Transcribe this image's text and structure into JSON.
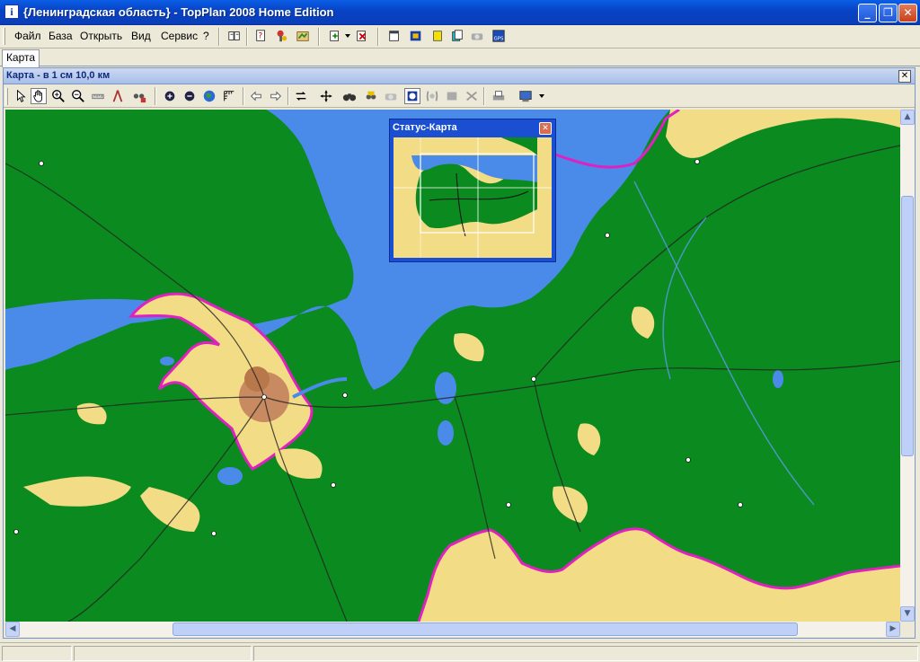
{
  "window": {
    "title": "{Ленинградская область} - TopPlan 2008 Home Edition",
    "app_icon_glyph": "i",
    "min_glyph": "_",
    "max_glyph": "❐",
    "close_glyph": "✕"
  },
  "menu": [
    {
      "label": "Файл"
    },
    {
      "label": "База"
    },
    {
      "label": "Открыть"
    },
    {
      "label": "Вид"
    },
    {
      "label": "Сервис"
    },
    {
      "label": "?"
    }
  ],
  "main_toolbar": [
    "book-icon",
    "help-cursor-icon",
    "tools-icon",
    "map-settings-icon",
    "add-layer-icon",
    "delete-layer-icon",
    "window-icon",
    "layers-icon",
    "note-icon",
    "copy-icon",
    "camera-icon",
    "gps-icon"
  ],
  "tabs": [
    {
      "label": "Карта"
    }
  ],
  "map_window": {
    "title": "Карта - в 1 см 10,0 км",
    "close_glyph": "✕"
  },
  "map_toolbar": [
    "pointer-icon",
    "hand-icon",
    "zoom-in-icon",
    "zoom-out-icon",
    "ruler-icon",
    "compass-icon",
    "find-icon",
    "zoom-plus-icon",
    "zoom-minus-icon",
    "globe-icon",
    "scale-icon",
    "back-icon",
    "forward-icon",
    "refresh-icon",
    "center-icon",
    "binoculars-icon",
    "object-icon",
    "camera-icon",
    "region-icon",
    "track-icon",
    "rectangle-icon",
    "route-icon",
    "print-icon",
    "export-icon"
  ],
  "status_map": {
    "title": "Статус-Карта",
    "close_glyph": "✕"
  },
  "scroll": {
    "up": "▲",
    "down": "▼",
    "left": "◀",
    "right": "▶"
  },
  "colors": {
    "forest": "#0a8a1f",
    "field": "#f2dc85",
    "water": "#4a8ae8",
    "border": "#e020c0",
    "city": "#c88a60"
  }
}
